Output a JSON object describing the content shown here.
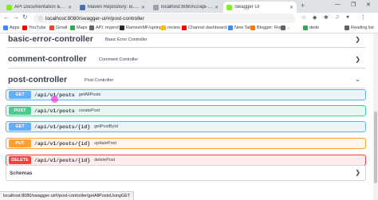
{
  "tabs": [
    {
      "title": "API Documentation & Design To",
      "favicon_color": "#85ea2d",
      "active": false
    },
    {
      "title": "Maven Repository: io.springfox",
      "favicon_color": "#4a6fa5",
      "active": false
    },
    {
      "title": "localhost:8080/v2/api-docs",
      "favicon_color": "#9aa0a6",
      "active": false
    },
    {
      "title": "Swagger UI",
      "favicon_color": "#85ea2d",
      "active": true
    }
  ],
  "address": {
    "url": "localhost:8080/swagger-ui/#/post-controller"
  },
  "bookmarks": [
    {
      "label": "Apps",
      "color": "#4285f4"
    },
    {
      "label": "YouTube",
      "color": "#ff0000"
    },
    {
      "label": "Gmail",
      "color": "#ea4335"
    },
    {
      "label": "Maps",
      "color": "#34a853"
    },
    {
      "label": "API: myprof...",
      "color": "#5f6368"
    },
    {
      "label": "RameshMF/spring-...",
      "color": "#24292e"
    },
    {
      "label": "review",
      "color": "#fbbc04"
    },
    {
      "label": "Channel dashboard...",
      "color": "#ff0000"
    },
    {
      "label": "New Tab",
      "color": "#4285f4"
    },
    {
      "label": "Blogger: Rode",
      "color": "#f57c00"
    },
    {
      "label": "...",
      "color": "#5f6368"
    },
    {
      "label": "dede",
      "color": "#34a853"
    },
    {
      "label": "Reading list",
      "color": "#5f6368"
    }
  ],
  "sections": [
    {
      "name": "basic-error-controller",
      "desc": "Basic Error Controller",
      "expanded": false
    },
    {
      "name": "comment-controller",
      "desc": "Comment Controller",
      "expanded": false
    },
    {
      "name": "post-controller",
      "desc": "Post Controller",
      "expanded": true
    }
  ],
  "operations": [
    {
      "method": "GET",
      "path": "/api/v1/posts",
      "summary": "getAllPosts",
      "color": "#61affe",
      "bg": "#ebf3fb"
    },
    {
      "method": "POST",
      "path": "/api/v1/posts",
      "summary": "createPost",
      "color": "#49cc90",
      "bg": "#e8f6f0"
    },
    {
      "method": "GET",
      "path": "/api/v1/posts/{id}",
      "summary": "getPostById",
      "color": "#61affe",
      "bg": "#ebf3fb"
    },
    {
      "method": "PUT",
      "path": "/api/v1/posts/{id}",
      "summary": "updatePost",
      "color": "#fca130",
      "bg": "#fff5ea"
    },
    {
      "method": "DELETE",
      "path": "/api/v1/posts/{id}",
      "summary": "deletePost",
      "color": "#f93e3e",
      "bg": "#feebeb"
    }
  ],
  "schemas": {
    "label": "Schemas"
  },
  "status_url": "localhost:8080/swagger-ui/#/post-controller/getAllPostsUsingGET",
  "icons": {
    "chevron_collapsed": "chevron-right-icon",
    "chevron_expanded": "chevron-down-icon"
  }
}
